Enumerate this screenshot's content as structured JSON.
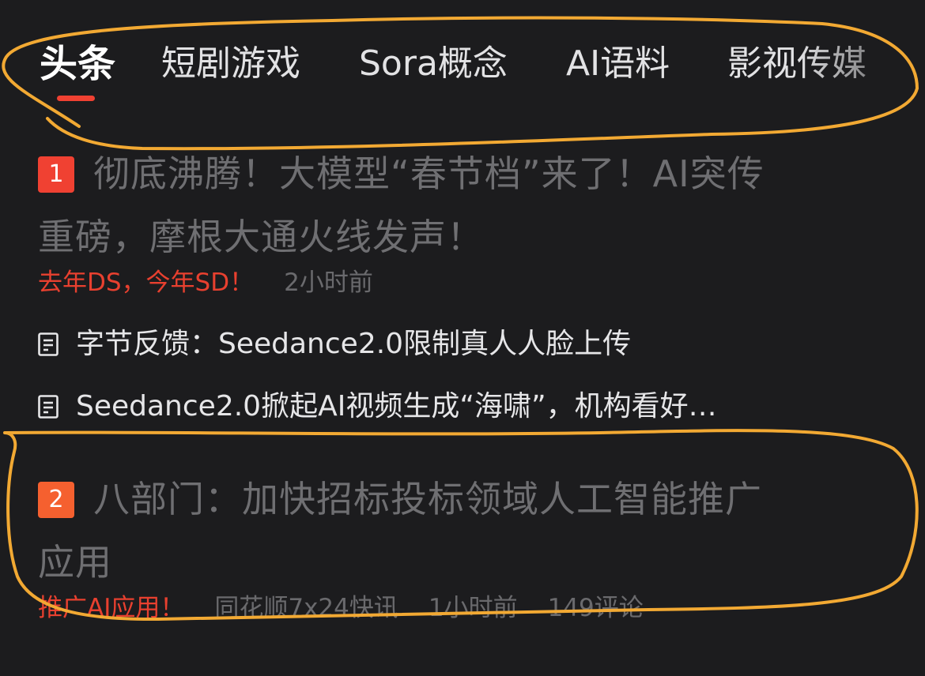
{
  "tabs": [
    {
      "label": "头条",
      "active": true
    },
    {
      "label": "短剧游戏",
      "active": false
    },
    {
      "label": "Sora概念",
      "active": false
    },
    {
      "label": "AI语料",
      "active": false
    },
    {
      "label": "影视传媒",
      "active": false
    }
  ],
  "articles": [
    {
      "rank": "1",
      "title_line1": "彻底沸腾！大模型“春节档”来了！AI突传",
      "title_line2": "重磅，摩根大通火线发声！",
      "tag": "去年DS，今年SD！",
      "time": "2小时前",
      "related": [
        "字节反馈：Seedance2.0限制真人人脸上传",
        "Seedance2.0掀起AI视频生成“海啸”，机构看好…"
      ]
    },
    {
      "rank": "2",
      "title_line1": "八部门：加快招标投标领域人工智能推广",
      "title_line2": "应用",
      "tag": "推广AI应用！",
      "source": "同花顺7x24快讯",
      "time": "1小时前",
      "comments": "149评论"
    }
  ],
  "icons": {
    "related_item": "document-icon"
  },
  "colors": {
    "background": "#1c1c1e",
    "accent_red": "#f04132",
    "rank2_orange": "#f5602f",
    "annotation_yellow": "#f2a933"
  }
}
